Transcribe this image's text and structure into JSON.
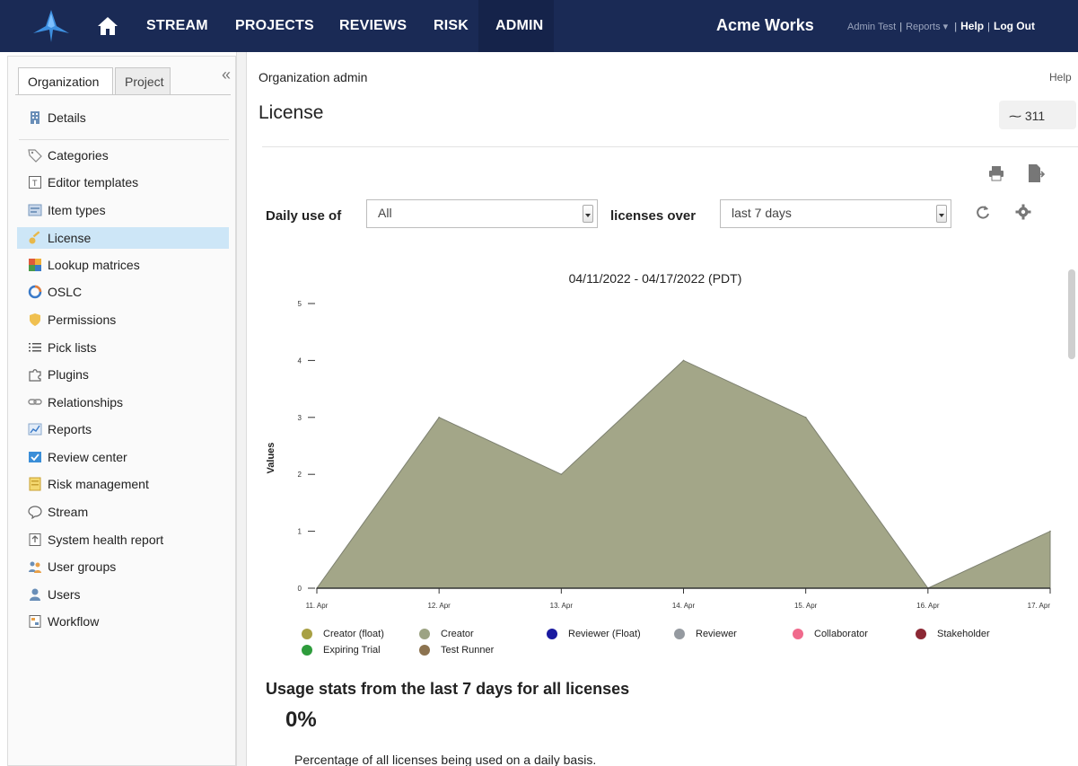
{
  "topnav": {
    "logo_icon": "jama-logo-icon",
    "home_icon": "home-icon",
    "links": [
      "STREAM",
      "PROJECTS",
      "REVIEWS",
      "RISK",
      "ADMIN"
    ],
    "active": "ADMIN",
    "company": "Acme Works",
    "user_links": {
      "user": "Admin Test",
      "reports": "Reports",
      "help": "Help",
      "logout": "Log Out"
    },
    "colors": {
      "bar": "#1a2a55",
      "active_bg": "#15234a"
    }
  },
  "sidebar": {
    "tabs": [
      "Organization",
      "Project"
    ],
    "active_tab": "Organization",
    "collapse_icon": "double-chevron-left-icon",
    "details": {
      "label": "Details",
      "icon": "building-icon"
    },
    "items": [
      {
        "label": "Categories",
        "icon": "tag-icon"
      },
      {
        "label": "Editor templates",
        "icon": "template-icon"
      },
      {
        "label": "Item types",
        "icon": "item-types-icon"
      },
      {
        "label": "License",
        "icon": "key-icon",
        "active": true
      },
      {
        "label": "Lookup matrices",
        "icon": "matrix-icon"
      },
      {
        "label": "OSLC",
        "icon": "oslc-icon"
      },
      {
        "label": "Permissions",
        "icon": "shield-icon"
      },
      {
        "label": "Pick lists",
        "icon": "list-icon"
      },
      {
        "label": "Plugins",
        "icon": "puzzle-icon"
      },
      {
        "label": "Relationships",
        "icon": "link-icon"
      },
      {
        "label": "Reports",
        "icon": "chart-icon"
      },
      {
        "label": "Review center",
        "icon": "review-icon"
      },
      {
        "label": "Risk management",
        "icon": "risk-icon"
      },
      {
        "label": "Stream",
        "icon": "chat-bubble-icon"
      },
      {
        "label": "System health report",
        "icon": "health-report-icon"
      },
      {
        "label": "User groups",
        "icon": "user-groups-icon"
      },
      {
        "label": "Users",
        "icon": "user-icon"
      },
      {
        "label": "Workflow",
        "icon": "workflow-icon"
      }
    ]
  },
  "main": {
    "breadcrumb": "Organization admin",
    "help": "Help",
    "title": "License",
    "activity_count": "311",
    "activity_icon": "pulse-icon",
    "toolbar": {
      "print_icon": "print-icon",
      "export_icon": "export-icon"
    },
    "filter": {
      "label_daily_use": "Daily use of",
      "licenses_value": "All",
      "label_licenses_over": "licenses over",
      "period_value": "last 7 days",
      "refresh_icon": "refresh-icon",
      "settings_icon": "gear-icon"
    },
    "stats": {
      "heading": "Usage stats from the last 7 days for all licenses",
      "value": "0%",
      "description": "Percentage of all licenses being used on a daily basis."
    }
  },
  "chart_data": {
    "type": "area",
    "title": "04/11/2022 - 04/17/2022 (PDT)",
    "xlabel": "",
    "ylabel": "Values",
    "categories": [
      "11. Apr",
      "12. Apr",
      "13. Apr",
      "14. Apr",
      "15. Apr",
      "16. Apr",
      "17. Apr"
    ],
    "ylim": [
      0,
      5
    ],
    "yticks": [
      0,
      1,
      2,
      3,
      4,
      5
    ],
    "grid": false,
    "series": [
      {
        "name": "Creator (float)",
        "color": "#a8a044",
        "values": [
          0,
          0,
          0,
          0,
          0,
          0,
          0
        ]
      },
      {
        "name": "Creator",
        "color": "#9ca383",
        "values": [
          0,
          3,
          2,
          4,
          3,
          0,
          1
        ]
      },
      {
        "name": "Reviewer (Float)",
        "color": "#1a1aa0",
        "values": [
          0,
          0,
          0,
          0,
          0,
          0,
          0
        ]
      },
      {
        "name": "Reviewer",
        "color": "#959aa0",
        "values": [
          0,
          0,
          0,
          0,
          0,
          0,
          0
        ]
      },
      {
        "name": "Collaborator",
        "color": "#f06a8c",
        "values": [
          0,
          0,
          0,
          0,
          0,
          0,
          0
        ]
      },
      {
        "name": "Stakeholder",
        "color": "#8c2834",
        "values": [
          0,
          0,
          0,
          0,
          0,
          0,
          0
        ]
      },
      {
        "name": "Expiring Trial",
        "color": "#2e9c3c",
        "values": [
          0,
          0,
          0,
          0,
          0,
          0,
          0
        ]
      },
      {
        "name": "Test Runner",
        "color": "#8c7350",
        "values": [
          0,
          0,
          0,
          0,
          0,
          0,
          0
        ]
      }
    ],
    "fill_color": "#a3a688",
    "legend_position": "bottom"
  }
}
